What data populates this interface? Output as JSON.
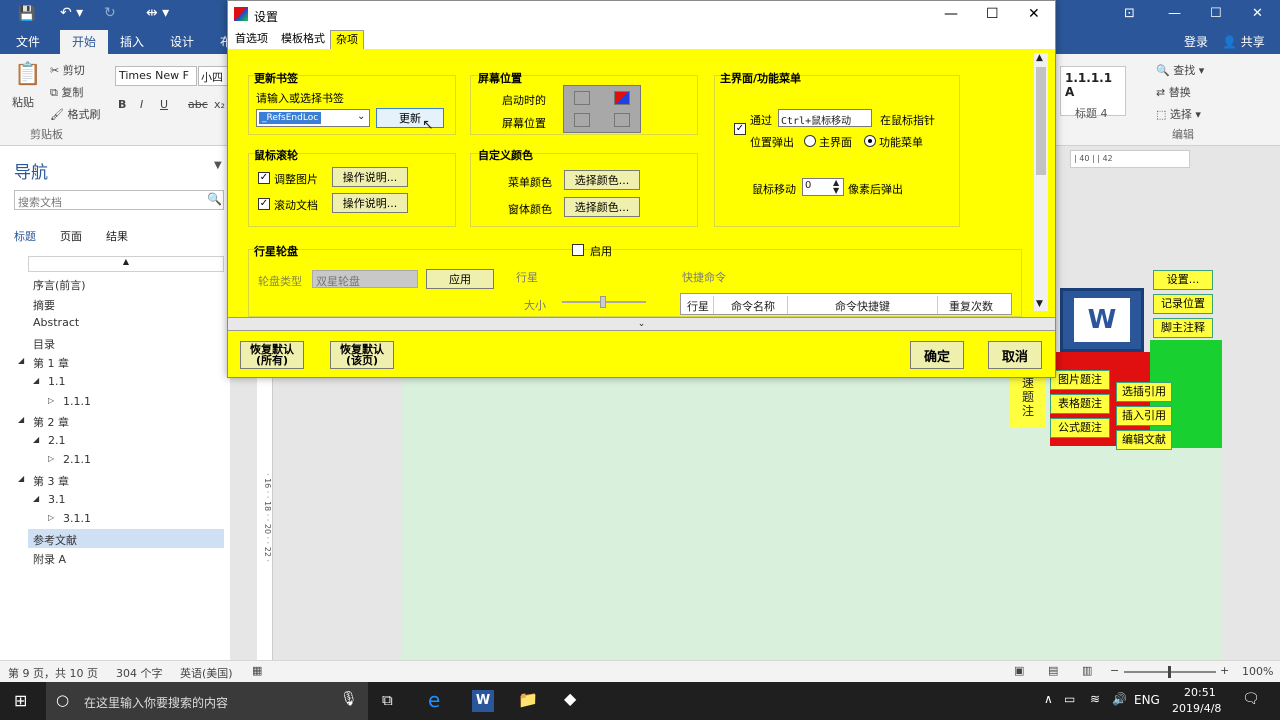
{
  "titlebar": {
    "min": "—",
    "max": "☐",
    "close": "✕",
    "ribbon_display": "⊡"
  },
  "tabs": [
    {
      "label": "文件"
    },
    {
      "label": "开始"
    },
    {
      "label": "插入"
    },
    {
      "label": "设计"
    },
    {
      "label": "布"
    }
  ],
  "account": {
    "login": "登录",
    "share": "共享"
  },
  "ribbon": {
    "paste": "粘贴",
    "cut": "剪切",
    "copy": "复制",
    "format_painter": "格式刷",
    "clipboard": "剪贴板",
    "font_name": "Times New F",
    "font_size": "小四",
    "bold": "B",
    "italic": "I",
    "underline": "U",
    "strike": "abc",
    "sub": "x₂",
    "style_preview": "1.1.1.1  A",
    "style_name": "标题 4",
    "find": "查找",
    "replace": "替换",
    "select": "选择",
    "editing": "编辑"
  },
  "nav": {
    "title": "导航",
    "search_placeholder": "搜索文档",
    "tabs": [
      "标题",
      "页面",
      "结果"
    ],
    "items": [
      {
        "label": "序言(前言)",
        "indent": 0
      },
      {
        "label": "摘要",
        "indent": 0
      },
      {
        "label": "Abstract",
        "indent": 0
      },
      {
        "label": "目录",
        "indent": 0
      },
      {
        "label": "第 1 章",
        "indent": 0,
        "arrow": "◢"
      },
      {
        "label": "1.1",
        "indent": 1,
        "arrow": "◢"
      },
      {
        "label": "1.1.1",
        "indent": 2,
        "arrow": "▷"
      },
      {
        "label": "第 2 章",
        "indent": 0,
        "arrow": "◢"
      },
      {
        "label": "2.1",
        "indent": 1,
        "arrow": "◢"
      },
      {
        "label": "2.1.1",
        "indent": 2,
        "arrow": "▷"
      },
      {
        "label": "第 3 章",
        "indent": 0,
        "arrow": "◢"
      },
      {
        "label": "3.1",
        "indent": 1,
        "arrow": "◢"
      },
      {
        "label": "3.1.1",
        "indent": 2,
        "arrow": "▷"
      },
      {
        "label": "参考文献",
        "indent": 0,
        "selected": true
      },
      {
        "label": "附录 A",
        "indent": 0
      }
    ]
  },
  "ruler": {
    "marks": "| 40 |  | 42"
  },
  "side_buttons": [
    "设置...",
    "记录位置",
    "脚主注释"
  ],
  "word_logo": "W",
  "toolbox": {
    "quick": "速\n题\n注",
    "img_cap": "图片题注",
    "tbl_cap": "表格题注",
    "eq_cap": "公式题注",
    "sel_ref": "选插引用",
    "ins_ref": "插入引用",
    "edit_ref": "编辑文献"
  },
  "dialog": {
    "title": "设置",
    "tabs": [
      "首选项",
      "模板格式",
      "杂项"
    ],
    "bookmark": {
      "title": "更新书签",
      "prompt": "请输入或选择书签",
      "value": "_RefsEndLoc",
      "update": "更新"
    },
    "screen": {
      "title": "屏幕位置",
      "startup": "启动时的",
      "position": "屏幕位置"
    },
    "mainui": {
      "title": "主界面/功能菜单",
      "via": "通过",
      "shortcut": "Ctrl+鼠标移动",
      "at_pointer": "在鼠标指针",
      "popup": "位置弹出",
      "opt_main": "主界面",
      "opt_menu": "功能菜单",
      "mouse_move": "鼠标移动",
      "pixels": "0",
      "after": "像素后弹出"
    },
    "wheel": {
      "title": "鼠标滚轮",
      "adjust_img": "调整图片",
      "scroll_doc": "滚动文档",
      "help": "操作说明..."
    },
    "colors": {
      "title": "自定义颜色",
      "menu_color": "菜单颜色",
      "window_color": "窗体颜色",
      "choose": "选择颜色..."
    },
    "wheel_menu": {
      "title": "行星轮盘",
      "enable": "启用",
      "type_label": "轮盘类型",
      "type_value": "双星轮盘",
      "apply": "应用",
      "planet": "行星",
      "size": "大小",
      "shortcuts": "快捷命令"
    },
    "shortcut_table": {
      "headers": [
        "行星",
        "命令名称",
        "命令快捷键",
        "重复次数"
      ]
    },
    "restore_all": "恢复默认\n(所有)",
    "restore_page": "恢复默认\n(该页)",
    "ok": "确定",
    "cancel": "取消"
  },
  "status": {
    "page": "第 9 页，共 10 页",
    "words": "304 个字",
    "lang": "英语(美国)",
    "zoom": "100%"
  },
  "taskbar": {
    "search": "在这里输入你要搜索的内容",
    "ime": "ENG",
    "time": "20:51",
    "date": "2019/4/8"
  }
}
